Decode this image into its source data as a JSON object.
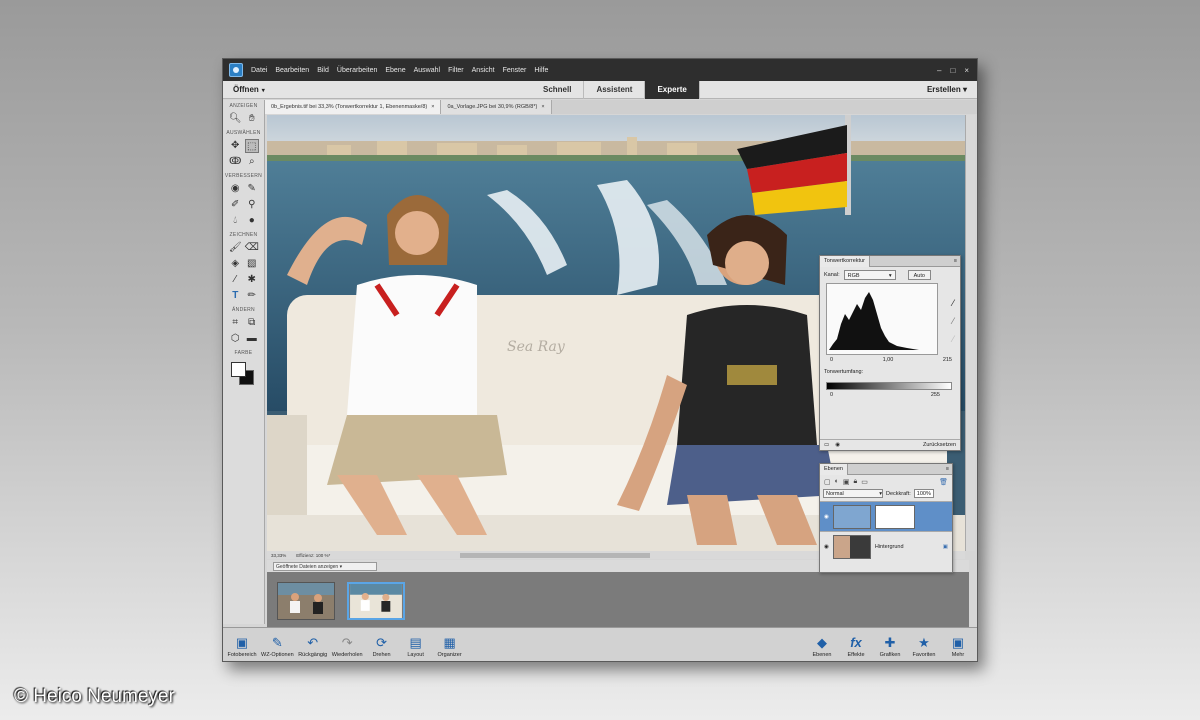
{
  "menubar": {
    "items": [
      "Datei",
      "Bearbeiten",
      "Bild",
      "Überarbeiten",
      "Ebene",
      "Auswahl",
      "Filter",
      "Ansicht",
      "Fenster",
      "Hilfe"
    ],
    "minimize": "–",
    "maximize": "□",
    "close": "×"
  },
  "modebar": {
    "open_label": "Öffnen",
    "tabs": [
      "Schnell",
      "Assistent",
      "Experte"
    ],
    "active_tab": "Experte",
    "create_label": "Erstellen"
  },
  "toolbox": {
    "sections": [
      "ANZEIGEN",
      "AUSWÄHLEN",
      "VERBESSERN",
      "ZEICHNEN",
      "ÄNDERN",
      "FARBE"
    ]
  },
  "document_tabs": [
    "0b_Ergebnis.tif bei 33,3% (Tonwertkorrektur 1, Ebenenmaske/8)",
    "0a_Vorlage.JPG bei 30,9% (RGB/8*)"
  ],
  "status": {
    "zoom": "33,33%",
    "info": "Effizienz: 100 %*"
  },
  "filmstrip": {
    "dropdown_label": "Geöffnete Dateien anzeigen"
  },
  "levels_panel": {
    "tab": "Tonwertkorrektur",
    "channel_label": "Kanal:",
    "channel_value": "RGB",
    "auto_label": "Auto",
    "input_black": "0",
    "input_gamma": "1,00",
    "input_white": "215",
    "output_label": "Tonwertumfang:",
    "output_black": "0",
    "output_white": "255",
    "reset_label": "Zurücksetzen"
  },
  "layers_panel": {
    "tab": "Ebenen",
    "blend_mode": "Normal",
    "opacity_label": "Deckkraft:",
    "opacity_value": "100%",
    "layers": [
      "",
      "Hintergrund"
    ]
  },
  "bottombar": {
    "left": [
      "Fotobereich",
      "WZ-Optionen",
      "Rückgängig",
      "Wiederholen",
      "Drehen",
      "Layout",
      "Organizer"
    ],
    "right": [
      "Ebenen",
      "Effekte",
      "Grafiken",
      "Favoriten",
      "Mehr"
    ]
  },
  "copyright": "© Heico Neumeyer"
}
